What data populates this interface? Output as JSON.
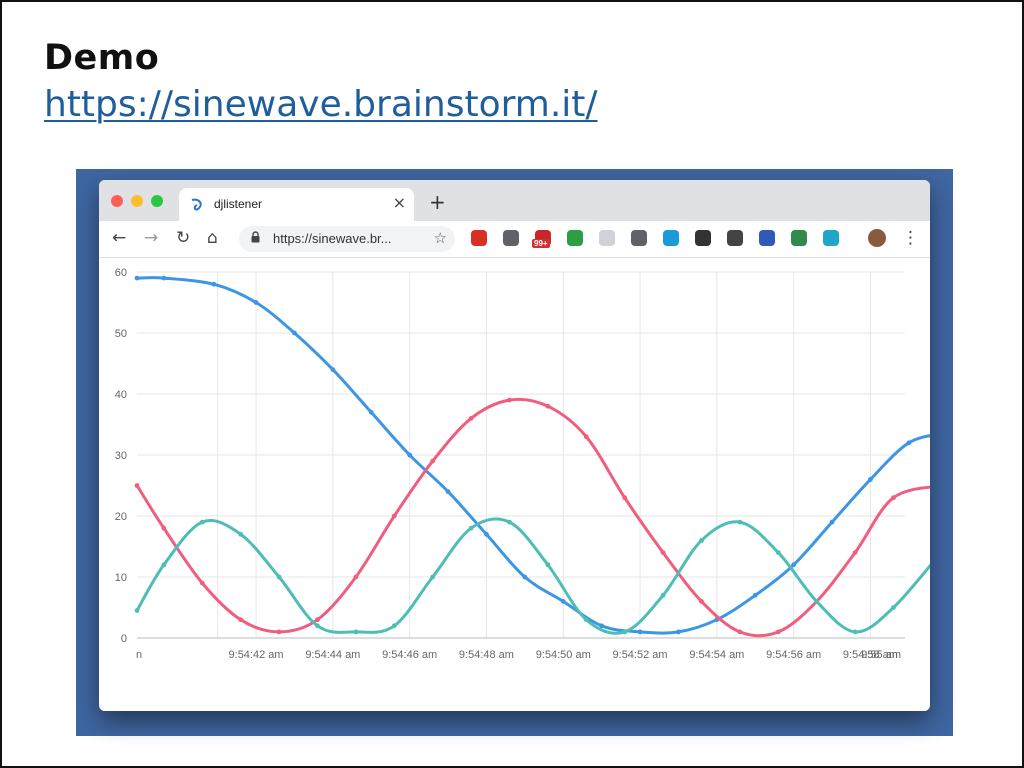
{
  "slide": {
    "title": "Demo",
    "link": "https://sinewave.brainstorm.it/"
  },
  "browser": {
    "tab_title": "djlistener",
    "tab_close": "×",
    "new_tab": "+",
    "url": "https://sinewave.br...",
    "nav": {
      "back": "←",
      "forward": "→",
      "reload": "↻",
      "home": "⌂",
      "star": "☆",
      "menu": "⋮"
    },
    "extensions": [
      {
        "name": "stop-extension-icon",
        "color": "#d93025"
      },
      {
        "name": "eyedropper-extension-icon",
        "color": "#5f6368"
      },
      {
        "name": "badge-extension-icon",
        "color": "#c62828",
        "badge": "99+"
      },
      {
        "name": "green-extension-icon",
        "color": "#2e9e44"
      },
      {
        "name": "grey-extension-icon",
        "color": "#cfd2d6"
      },
      {
        "name": "eye-extension-icon",
        "color": "#5f6368"
      },
      {
        "name": "ghost-extension-icon",
        "color": "#1a9bd7"
      },
      {
        "name": "sync-extension-icon",
        "color": "#333333"
      },
      {
        "name": "bulb-extension-icon",
        "color": "#444444"
      },
      {
        "name": "bookmark-extension-icon",
        "color": "#2f5bb7"
      },
      {
        "name": "globe-extension-icon",
        "color": "#2f8a4c"
      },
      {
        "name": "bird-extension-icon",
        "color": "#1fa6c9"
      },
      {
        "name": "avatar",
        "color": "#8a5a3c"
      }
    ]
  },
  "colors": {
    "blue": "#3d96e3",
    "red": "#f05d7f",
    "teal": "#4dbdb6",
    "grid": "#e6e6e6"
  },
  "chart_data": {
    "type": "line",
    "y_range": [
      0,
      60
    ],
    "x_range_seconds": [
      -3.1,
      16.9
    ],
    "y_ticks": [
      "0",
      "10",
      "20",
      "30",
      "40",
      "50",
      "60"
    ],
    "x_ticks": [
      {
        "t": -1,
        "label": "n"
      },
      {
        "t": 0,
        "label": "9:54:42 am"
      },
      {
        "t": 2,
        "label": "9:54:44 am"
      },
      {
        "t": 4,
        "label": "9:54:46 am"
      },
      {
        "t": 6,
        "label": "9:54:48 am"
      },
      {
        "t": 8,
        "label": "9:54:50 am"
      },
      {
        "t": 10,
        "label": "9:54:52 am"
      },
      {
        "t": 12,
        "label": "9:54:54 am"
      },
      {
        "t": 14,
        "label": "9:54:56 am"
      },
      {
        "t": 16,
        "label": "9:54:58 am"
      },
      {
        "t": 18,
        "label": "9:55 am"
      }
    ],
    "series": [
      {
        "color": "#3d96e3",
        "points": [
          [
            -3.1,
            59
          ],
          [
            -2.4,
            59
          ],
          [
            -1.1,
            58
          ],
          [
            0.0,
            55
          ],
          [
            1.0,
            50
          ],
          [
            2.0,
            44
          ],
          [
            3.0,
            37
          ],
          [
            4.0,
            30
          ],
          [
            5.0,
            24
          ],
          [
            6.0,
            17
          ],
          [
            7.0,
            10
          ],
          [
            8.0,
            6
          ],
          [
            9.0,
            2
          ],
          [
            10.0,
            1
          ],
          [
            11.0,
            1
          ],
          [
            12.0,
            3
          ],
          [
            13.0,
            7
          ],
          [
            14.0,
            12
          ],
          [
            15.0,
            19
          ],
          [
            16.0,
            26
          ],
          [
            17.0,
            32
          ],
          [
            17.9,
            33.5
          ]
        ]
      },
      {
        "color": "#f05d7f",
        "points": [
          [
            -3.1,
            25
          ],
          [
            -2.4,
            18
          ],
          [
            -1.4,
            9
          ],
          [
            -0.4,
            3
          ],
          [
            0.6,
            1
          ],
          [
            1.6,
            3
          ],
          [
            2.6,
            10
          ],
          [
            3.6,
            20
          ],
          [
            4.6,
            29
          ],
          [
            5.6,
            36
          ],
          [
            6.6,
            39
          ],
          [
            7.6,
            38
          ],
          [
            8.6,
            33
          ],
          [
            9.6,
            23
          ],
          [
            10.6,
            14
          ],
          [
            11.6,
            6
          ],
          [
            12.6,
            1
          ],
          [
            13.6,
            1
          ],
          [
            14.6,
            6
          ],
          [
            15.6,
            14
          ],
          [
            16.6,
            23
          ],
          [
            17.9,
            25
          ]
        ]
      },
      {
        "color": "#4dbdb6",
        "points": [
          [
            -3.1,
            4.5
          ],
          [
            -2.4,
            12
          ],
          [
            -1.4,
            19
          ],
          [
            -0.4,
            17
          ],
          [
            0.6,
            10
          ],
          [
            1.6,
            2
          ],
          [
            2.6,
            1
          ],
          [
            3.6,
            2
          ],
          [
            4.6,
            10
          ],
          [
            5.6,
            18
          ],
          [
            6.6,
            19
          ],
          [
            7.6,
            12
          ],
          [
            8.6,
            3
          ],
          [
            9.6,
            1
          ],
          [
            10.6,
            7
          ],
          [
            11.6,
            16
          ],
          [
            12.6,
            19
          ],
          [
            13.6,
            14
          ],
          [
            14.6,
            6
          ],
          [
            15.6,
            1
          ],
          [
            16.6,
            5
          ],
          [
            17.9,
            14.5
          ]
        ]
      }
    ]
  }
}
